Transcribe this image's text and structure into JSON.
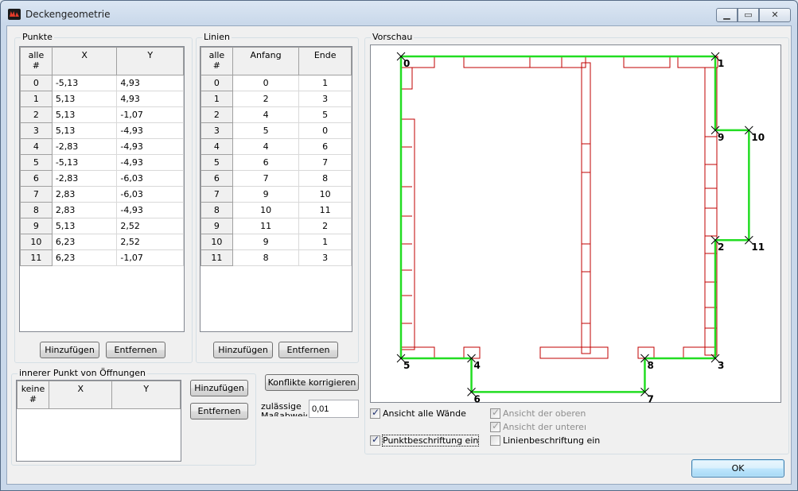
{
  "window": {
    "title": "Deckengeometrie",
    "min_glyph": "▁",
    "max_glyph": "▭",
    "close_glyph": "✕"
  },
  "punkte": {
    "legend": "Punkte",
    "columns": [
      "alle\n#",
      "X",
      "Y"
    ],
    "rows": [
      [
        "0",
        "-5,13",
        "4,93"
      ],
      [
        "1",
        "5,13",
        "4,93"
      ],
      [
        "2",
        "5,13",
        "-1,07"
      ],
      [
        "3",
        "5,13",
        "-4,93"
      ],
      [
        "4",
        "-2,83",
        "-4,93"
      ],
      [
        "5",
        "-5,13",
        "-4,93"
      ],
      [
        "6",
        "-2,83",
        "-6,03"
      ],
      [
        "7",
        "2,83",
        "-6,03"
      ],
      [
        "8",
        "2,83",
        "-4,93"
      ],
      [
        "9",
        "5,13",
        "2,52"
      ],
      [
        "10",
        "6,23",
        "2,52"
      ],
      [
        "11",
        "6,23",
        "-1,07"
      ]
    ],
    "add_label": "Hinzufügen",
    "remove_label": "Entfernen"
  },
  "linien": {
    "legend": "Linien",
    "columns": [
      "alle\n#",
      "Anfang",
      "Ende"
    ],
    "rows": [
      [
        "0",
        "0",
        "1"
      ],
      [
        "1",
        "2",
        "3"
      ],
      [
        "2",
        "4",
        "5"
      ],
      [
        "3",
        "5",
        "0"
      ],
      [
        "4",
        "4",
        "6"
      ],
      [
        "5",
        "6",
        "7"
      ],
      [
        "6",
        "7",
        "8"
      ],
      [
        "7",
        "9",
        "10"
      ],
      [
        "8",
        "10",
        "11"
      ],
      [
        "9",
        "11",
        "2"
      ],
      [
        "10",
        "9",
        "1"
      ],
      [
        "11",
        "8",
        "3"
      ]
    ],
    "add_label": "Hinzufügen",
    "remove_label": "Entfernen"
  },
  "oeffnungen": {
    "legend": "innerer Punkt von Öffnungen",
    "columns": [
      "keine\n#",
      "X",
      "Y"
    ],
    "add_label": "Hinzufügen",
    "remove_label": "Entfernen"
  },
  "konflikte_label": "Konflikte korrigieren",
  "tolerance": {
    "label": "zulässige\nMaßabweichung",
    "value": "0,01"
  },
  "vorschau": {
    "legend": "Vorschau",
    "point_labels": [
      {
        "n": "0",
        "x": -5.13,
        "y": 4.93
      },
      {
        "n": "1",
        "x": 5.13,
        "y": 4.93
      },
      {
        "n": "2",
        "x": 5.13,
        "y": -1.07
      },
      {
        "n": "3",
        "x": 5.13,
        "y": -4.93
      },
      {
        "n": "4",
        "x": -2.83,
        "y": -4.93
      },
      {
        "n": "5",
        "x": -5.13,
        "y": -4.93
      },
      {
        "n": "6",
        "x": -2.83,
        "y": -6.03
      },
      {
        "n": "7",
        "x": 2.83,
        "y": -6.03
      },
      {
        "n": "8",
        "x": 2.83,
        "y": -4.93
      },
      {
        "n": "9",
        "x": 5.13,
        "y": 2.52
      },
      {
        "n": "10",
        "x": 6.23,
        "y": 2.52
      },
      {
        "n": "11",
        "x": 6.23,
        "y": -1.07
      }
    ],
    "outline_color": "#22dd22",
    "wall_color": "#c00000"
  },
  "options": {
    "alle_waende": {
      "label": "Ansicht alle Wände",
      "checked": true
    },
    "punktbeschriftung": {
      "label": "Punktbeschriftung ein",
      "checked": true
    },
    "obere": {
      "label": "Ansicht der oberen ar",
      "checked": true
    },
    "untere": {
      "label": "Ansicht der unteren a",
      "checked": true
    },
    "linienbeschriftung": {
      "label": "Linienbeschriftung ein",
      "checked": false
    }
  },
  "ok_label": "OK"
}
